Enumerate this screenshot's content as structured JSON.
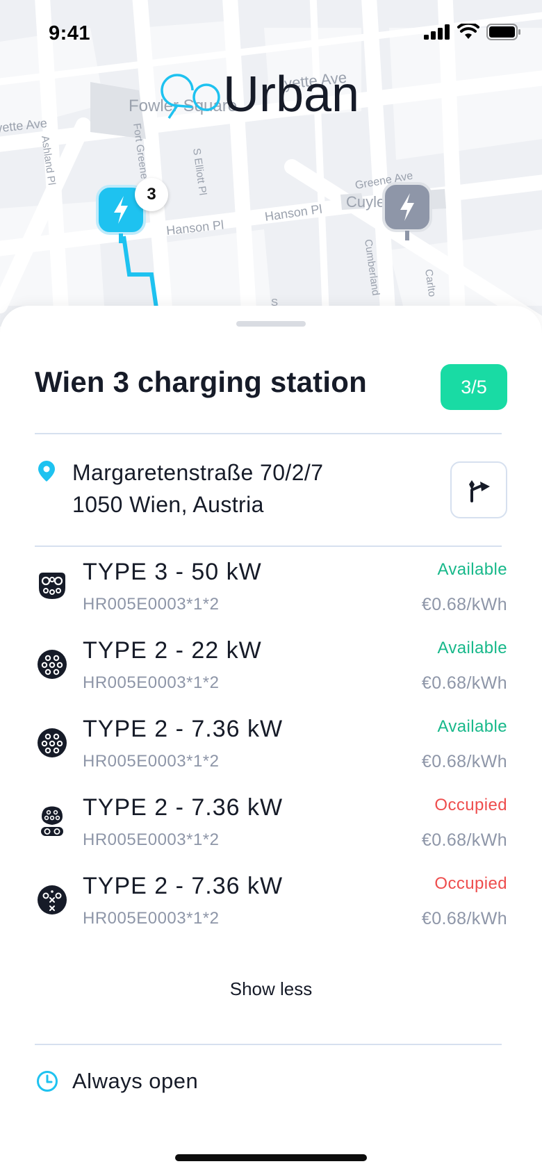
{
  "status_bar": {
    "time": "9:41"
  },
  "map": {
    "streets": [
      "yette Ave",
      "Ashland Pl",
      "Fort Greene",
      "S Elliott Pl",
      "Hanson Pl",
      "Hanson Pl",
      "Greene Ave",
      "Cuyle",
      "Cumberland",
      "Carlto",
      "S",
      "Fowler Square",
      "yette Ave"
    ],
    "cluster_count": "3"
  },
  "logo": {
    "text": "Urban",
    "prefix_icon": "go-logo-icon"
  },
  "station": {
    "title": "Wien 3 charging station",
    "availability": "3/5",
    "address_line1": "Margaretenstraße 70/2/7",
    "address_line2": "1050 Wien, Austria"
  },
  "connectors": [
    {
      "type": "TYPE 3 - 50 kW",
      "id": "HR005E0003*1*2",
      "status": "Available",
      "price": "€0.68/kWh",
      "icon": "type3-plug-icon"
    },
    {
      "type": "TYPE 2 - 22 kW",
      "id": "HR005E0003*1*2",
      "status": "Available",
      "price": "€0.68/kWh",
      "icon": "type2-plug-icon"
    },
    {
      "type": "TYPE 2 - 7.36 kW",
      "id": "HR005E0003*1*2",
      "status": "Available",
      "price": "€0.68/kWh",
      "icon": "type2-plug-icon"
    },
    {
      "type": "TYPE 2 - 7.36 kW",
      "id": "HR005E0003*1*2",
      "status": "Occupied",
      "price": "€0.68/kWh",
      "icon": "ccs-plug-icon"
    },
    {
      "type": "TYPE 2 - 7.36 kW",
      "id": "HR005E0003*1*2",
      "status": "Occupied",
      "price": "€0.68/kWh",
      "icon": "chademo-plug-icon"
    }
  ],
  "actions": {
    "show_less": "Show less"
  },
  "hours": {
    "text": "Always open"
  },
  "colors": {
    "accent": "#1ec2f0",
    "badge": "#19dba4",
    "available": "#17b88a",
    "occupied": "#ee4d4d",
    "muted": "#8e96a8"
  }
}
